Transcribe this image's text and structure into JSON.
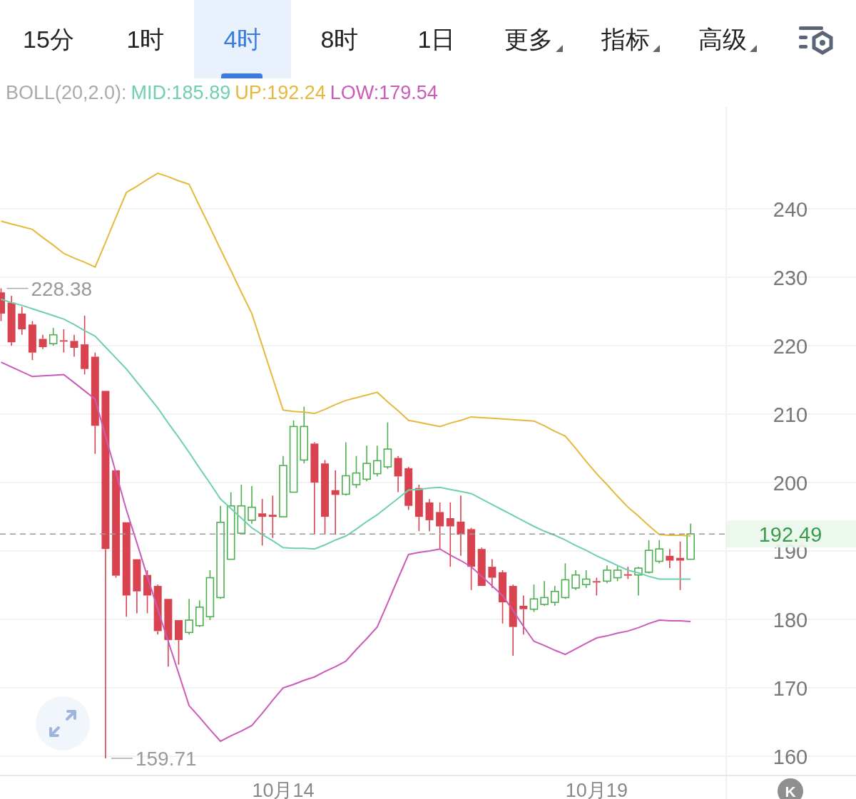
{
  "tabs": [
    {
      "label": "15分",
      "kind": "interval",
      "selected": false
    },
    {
      "label": "1时",
      "kind": "interval",
      "selected": false
    },
    {
      "label": "4时",
      "kind": "interval",
      "selected": true
    },
    {
      "label": "8时",
      "kind": "interval",
      "selected": false
    },
    {
      "label": "1日",
      "kind": "interval",
      "selected": false
    },
    {
      "label": "更多",
      "kind": "dropdown",
      "selected": false
    },
    {
      "label": "指标",
      "kind": "dropdown",
      "selected": false
    },
    {
      "label": "高级",
      "kind": "dropdown",
      "selected": false
    }
  ],
  "chart": {
    "legend_values": [
      ":185.89",
      ":192.24",
      ":179.54"
    ],
    "chart_data": {
      "type": "candlestick",
      "title": "BOLL(20,2.0):",
      "grid": true,
      "ylim": [
        157.2,
        254.9
      ],
      "yticks": [
        160,
        170,
        180,
        190,
        200,
        210,
        220,
        230,
        240
      ],
      "categories": [
        null,
        null,
        null,
        null,
        null,
        null,
        null,
        null,
        null,
        null,
        null,
        null,
        null,
        null,
        null,
        null,
        null,
        null,
        null,
        null,
        null,
        null,
        null,
        null,
        null,
        null,
        null,
        "10月14",
        null,
        null,
        null,
        null,
        null,
        null,
        null,
        null,
        null,
        null,
        null,
        null,
        null,
        null,
        null,
        null,
        null,
        null,
        null,
        null,
        null,
        null,
        null,
        null,
        null,
        null,
        null,
        null,
        null,
        "10月19",
        null,
        null,
        null,
        null,
        null,
        null,
        null,
        null,
        null
      ],
      "ohlc": [
        [
          227.8,
          228.38,
          223.6,
          224.7
        ],
        [
          226.3,
          227.3,
          220.0,
          220.5
        ],
        [
          224.7,
          225.7,
          221.6,
          222.4
        ],
        [
          223.1,
          223.6,
          217.9,
          219.0
        ],
        [
          221.0,
          221.6,
          219.5,
          219.8
        ],
        [
          220.3,
          222.6,
          220.0,
          221.6
        ],
        [
          220.8,
          222.4,
          219.0,
          220.6
        ],
        [
          220.7,
          221.6,
          218.4,
          219.7
        ],
        [
          220.2,
          224.4,
          215.8,
          216.6
        ],
        [
          218.4,
          219.0,
          204.2,
          208.3
        ],
        [
          213.4,
          213.4,
          159.71,
          190.3
        ],
        [
          201.8,
          201.8,
          186.1,
          186.4
        ],
        [
          194.2,
          194.2,
          180.4,
          183.5
        ],
        [
          188.8,
          188.8,
          180.9,
          184.1
        ],
        [
          186.5,
          187.2,
          180.9,
          183.5
        ],
        [
          184.9,
          185.1,
          177.8,
          178.3
        ],
        [
          183.0,
          183.0,
          173.1,
          177.0
        ],
        [
          179.9,
          179.9,
          173.4,
          177.0
        ],
        [
          178.1,
          183.0,
          177.8,
          179.9
        ],
        [
          179.1,
          182.8,
          178.9,
          181.8
        ],
        [
          180.4,
          187.2,
          179.9,
          186.1
        ],
        [
          183.2,
          196.6,
          183.0,
          194.2
        ],
        [
          188.8,
          198.6,
          188.8,
          196.6
        ],
        [
          192.6,
          199.7,
          192.4,
          196.6
        ],
        [
          194.5,
          199.5,
          194.0,
          196.4
        ],
        [
          195.5,
          197.6,
          190.8,
          195.0
        ],
        [
          195.3,
          198.1,
          191.9,
          195.0
        ],
        [
          195.0,
          203.9,
          195.0,
          202.5
        ],
        [
          198.6,
          209.1,
          198.6,
          208.2
        ],
        [
          203.3,
          211.1,
          202.8,
          208.2
        ],
        [
          205.7,
          205.9,
          192.4,
          200.0
        ],
        [
          202.8,
          203.3,
          192.4,
          195.0
        ],
        [
          198.9,
          201.8,
          192.4,
          198.2
        ],
        [
          198.3,
          205.9,
          198.1,
          201.0
        ],
        [
          199.7,
          203.9,
          199.2,
          201.4
        ],
        [
          200.5,
          205.4,
          200.2,
          202.8
        ],
        [
          201.3,
          205.4,
          200.9,
          203.2
        ],
        [
          202.3,
          208.8,
          202.0,
          204.9
        ],
        [
          203.6,
          203.9,
          198.6,
          200.9
        ],
        [
          202.1,
          202.3,
          196.0,
          196.6
        ],
        [
          199.2,
          199.7,
          192.9,
          195.0
        ],
        [
          197.1,
          197.6,
          192.9,
          194.5
        ],
        [
          195.7,
          197.1,
          190.3,
          193.6
        ],
        [
          194.8,
          197.1,
          187.7,
          193.6
        ],
        [
          194.3,
          198.1,
          189.3,
          192.4
        ],
        [
          193.2,
          193.4,
          184.3,
          187.7
        ],
        [
          190.3,
          190.5,
          184.9,
          184.9
        ],
        [
          187.7,
          188.8,
          184.6,
          186.1
        ],
        [
          186.9,
          187.2,
          179.4,
          182.5
        ],
        [
          184.9,
          185.1,
          174.7,
          178.9
        ],
        [
          182.0,
          183.5,
          177.8,
          181.5
        ],
        [
          181.5,
          185.1,
          181.1,
          183.0
        ],
        [
          182.2,
          185.6,
          182.0,
          183.2
        ],
        [
          182.5,
          184.9,
          182.0,
          184.1
        ],
        [
          183.2,
          188.2,
          183.0,
          185.8
        ],
        [
          184.6,
          187.2,
          184.3,
          186.5
        ],
        [
          185.1,
          187.2,
          184.6,
          185.9
        ],
        [
          185.6,
          186.1,
          183.5,
          185.4
        ],
        [
          185.6,
          187.9,
          185.3,
          187.2
        ],
        [
          186.1,
          187.9,
          185.6,
          187.2
        ],
        [
          186.6,
          187.7,
          185.9,
          186.4
        ],
        [
          186.5,
          187.7,
          183.5,
          187.5
        ],
        [
          186.9,
          191.6,
          186.7,
          190.1
        ],
        [
          188.5,
          191.6,
          188.2,
          190.3
        ],
        [
          189.3,
          190.3,
          187.5,
          188.6
        ],
        [
          189.0,
          191.4,
          184.3,
          188.6
        ],
        [
          188.8,
          194.0,
          188.8,
          192.49
        ]
      ],
      "series": [
        {
          "name": "UP",
          "type": "line",
          "color": "#e6b93c",
          "values": [
            238.2,
            237.8,
            237.4,
            237.0,
            235.8,
            234.7,
            233.5,
            232.8,
            232.2,
            231.5,
            235.1,
            238.8,
            242.4,
            243.3,
            244.3,
            245.2,
            244.7,
            244.1,
            243.6,
            240.4,
            237.3,
            234.1,
            231.0,
            227.8,
            224.7,
            220.0,
            215.3,
            210.6,
            210.4,
            210.3,
            210.1,
            210.7,
            211.4,
            212.0,
            212.4,
            212.8,
            213.2,
            211.8,
            210.5,
            209.1,
            208.8,
            208.5,
            208.2,
            208.7,
            209.1,
            209.6,
            209.5,
            209.4,
            209.3,
            209.2,
            209.1,
            209.0,
            208.3,
            207.5,
            206.8,
            205.0,
            203.1,
            201.3,
            199.7,
            198.0,
            196.4,
            195.1,
            193.7,
            192.4,
            192.3,
            192.3,
            192.2
          ]
        },
        {
          "name": "MID",
          "type": "line",
          "color": "#6fd0b0",
          "values": [
            226.8,
            226.3,
            225.9,
            225.4,
            224.9,
            224.4,
            223.9,
            223.1,
            222.2,
            221.4,
            219.8,
            218.2,
            216.6,
            214.7,
            212.8,
            210.9,
            208.7,
            206.6,
            204.4,
            202.1,
            199.9,
            197.6,
            196.2,
            194.8,
            193.4,
            192.4,
            191.5,
            190.5,
            190.4,
            190.4,
            190.3,
            190.9,
            191.6,
            192.2,
            193.2,
            194.3,
            195.3,
            196.5,
            197.7,
            198.9,
            199.0,
            199.2,
            199.3,
            199.0,
            198.7,
            198.4,
            197.6,
            196.8,
            196.0,
            195.2,
            194.4,
            193.6,
            192.9,
            192.3,
            191.6,
            190.8,
            190.1,
            189.3,
            188.6,
            187.9,
            187.2,
            186.8,
            186.3,
            185.9,
            185.9,
            185.9,
            185.9
          ]
        },
        {
          "name": "LOW",
          "type": "line",
          "color": "#cc5ab8",
          "values": [
            217.6,
            216.9,
            216.2,
            215.5,
            215.6,
            215.7,
            215.8,
            214.6,
            213.4,
            212.2,
            206.8,
            201.4,
            196.0,
            191.2,
            186.3,
            181.5,
            176.8,
            172.1,
            167.4,
            165.7,
            163.9,
            162.2,
            163.0,
            163.7,
            164.5,
            166.3,
            168.2,
            170.0,
            170.5,
            171.1,
            171.6,
            172.4,
            173.1,
            173.9,
            175.6,
            177.2,
            178.9,
            182.4,
            186.0,
            189.5,
            189.8,
            190.0,
            190.3,
            189.4,
            188.6,
            187.7,
            186.3,
            184.9,
            183.5,
            181.3,
            179.0,
            176.8,
            176.2,
            175.5,
            174.9,
            175.7,
            176.5,
            177.3,
            177.6,
            178.0,
            178.3,
            178.8,
            179.4,
            179.9,
            179.8,
            179.8,
            179.7
          ]
        }
      ],
      "annotations": [
        "228.38",
        "159.71"
      ],
      "ref_lines": [
        {
          "axis": "y",
          "value": 192.49,
          "label": "192.49"
        }
      ]
    }
  },
  "k_button": {
    "label": "K"
  }
}
